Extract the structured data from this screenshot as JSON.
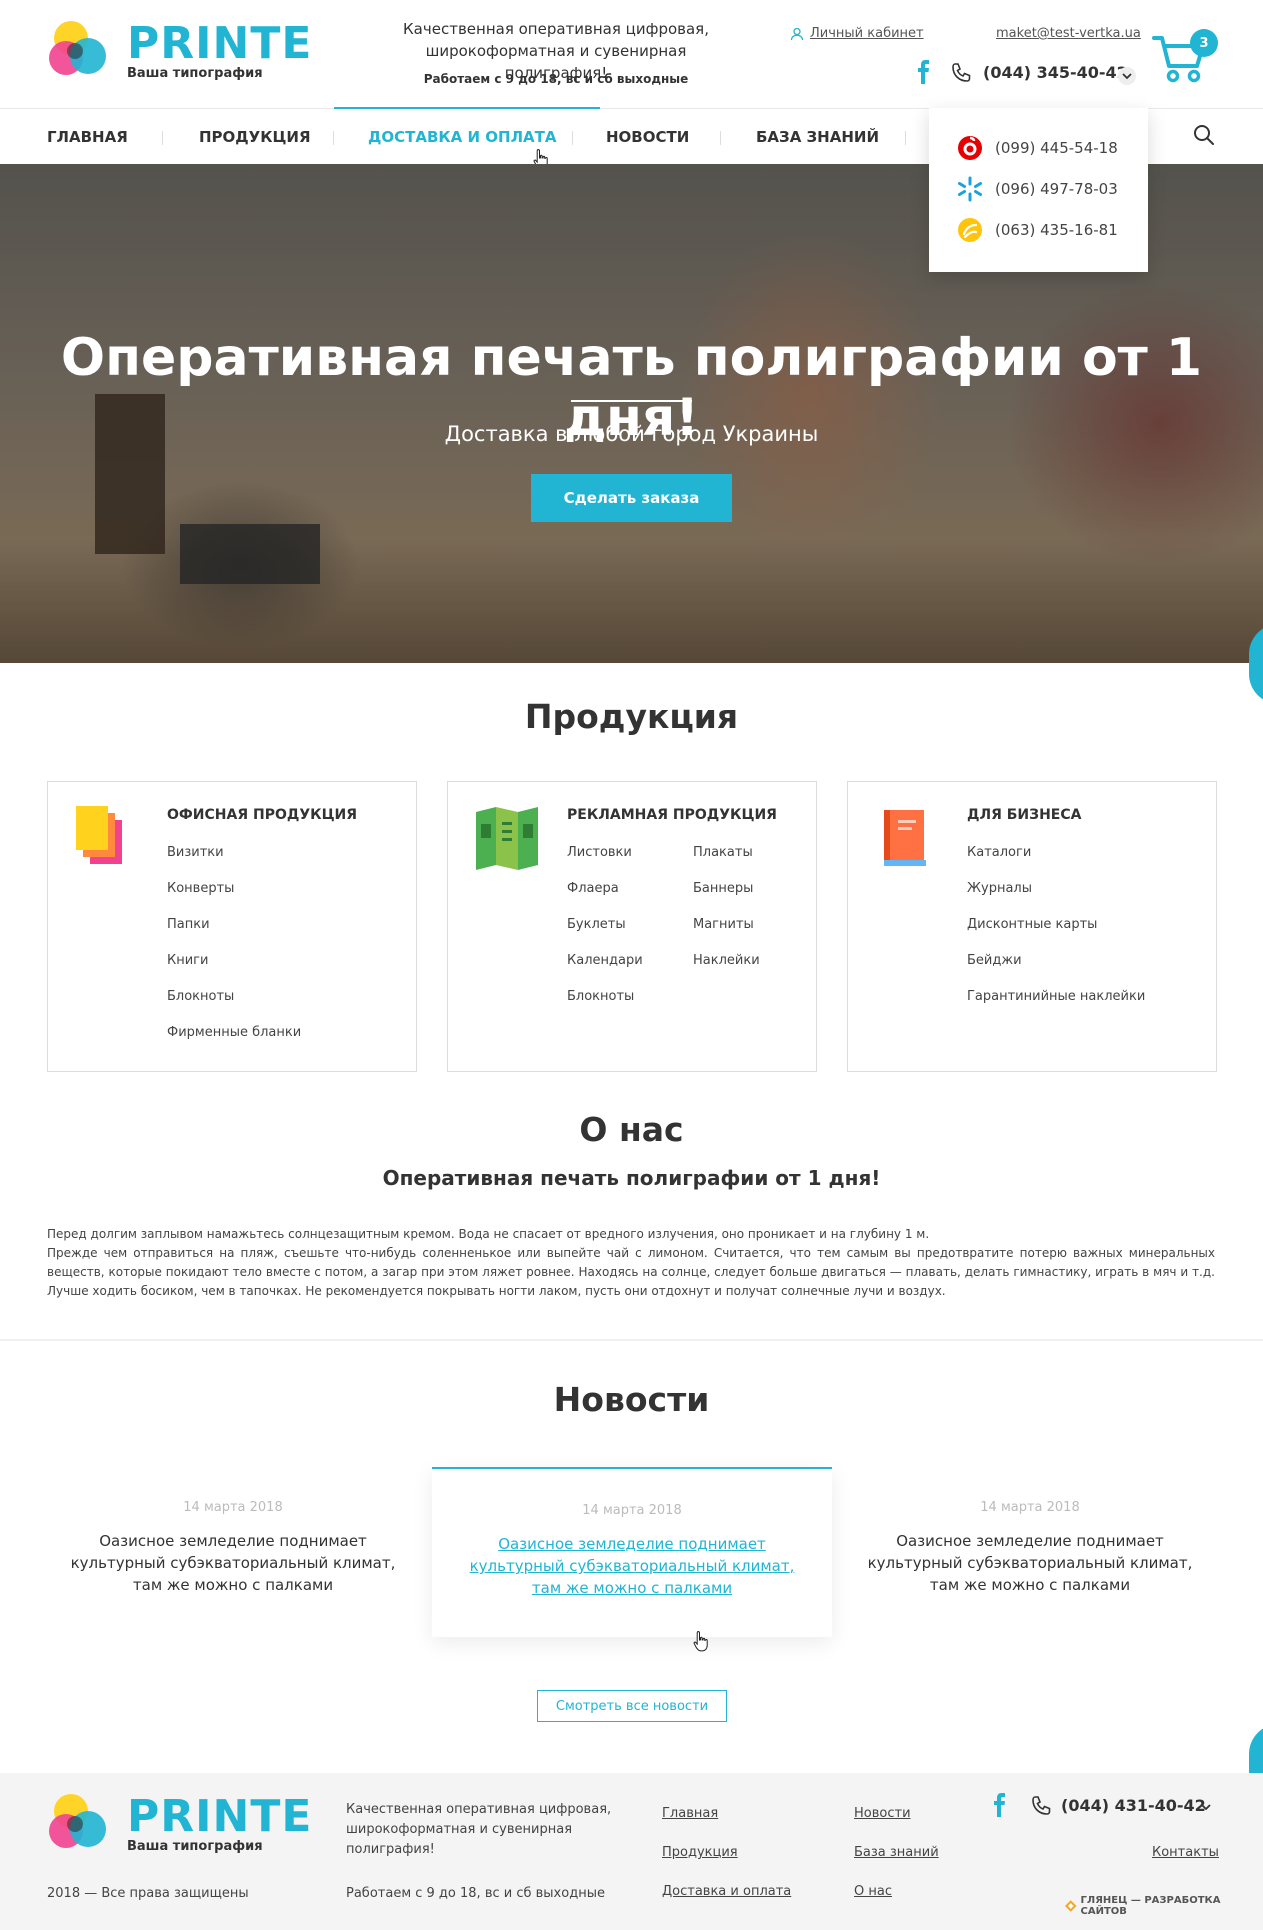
{
  "brand": {
    "name": "PRINTE",
    "tagline": "Ваша типография",
    "accent": "#21b5d3"
  },
  "header": {
    "info": "Качественная оперативная цифровая, широкоформатная и сувенирная полиграфия!",
    "hours": "Работаем с 9 до 18, вс и сб выходные",
    "cabinet_label": "Личный кабинет",
    "email": "maket@test-vertka.ua",
    "phone": "(044) 345-40-42",
    "cart_count": "3",
    "icons": [
      "user-icon",
      "facebook-icon",
      "phone-icon",
      "chevron-down-icon",
      "cart-icon",
      "search-icon"
    ]
  },
  "nav": {
    "items": [
      {
        "label": "Главная"
      },
      {
        "label": "Продукция"
      },
      {
        "label": "Доставка и оплата"
      },
      {
        "label": "Новости"
      },
      {
        "label": "База знаний"
      }
    ],
    "active": "Доставка и оплата"
  },
  "phones_dropdown": {
    "items": [
      {
        "operator_icon": "vodafone-icon",
        "color": "#e60000",
        "number": "(099) 445-54-18"
      },
      {
        "operator_icon": "kyivstar-icon",
        "color": "#1ba0e1",
        "number": "(096) 497-78-03"
      },
      {
        "operator_icon": "lifecell-icon",
        "color": "#ffc40c",
        "number": "(063) 435-16-81"
      }
    ]
  },
  "hero": {
    "title": "Оперативная печать полиграфии от 1 дня!",
    "subtitle": "Доставка в любой город Украины",
    "button_label": "Сделать заказа"
  },
  "products": {
    "title": "Продукция",
    "categories": [
      {
        "title": "Офисная продукция",
        "icon": "papers-icon",
        "columns": [
          [
            "Визитки",
            "Конверты",
            "Папки",
            "Книги",
            "Блокноты",
            "Фирменные бланки"
          ]
        ]
      },
      {
        "title": "Рекламная продукция",
        "icon": "brochure-icon",
        "columns": [
          [
            "Листовки",
            "Флаера",
            "Буклеты",
            "Календари",
            "Блокноты"
          ],
          [
            "Плакаты",
            "Баннеры",
            "Магниты",
            "Наклейки"
          ]
        ]
      },
      {
        "title": "Для бизнеса",
        "icon": "book-icon",
        "columns": [
          [
            "Каталоги",
            "Журналы",
            "Дисконтные карты",
            "Бейджи",
            "Гарантинийные наклейки"
          ]
        ]
      }
    ]
  },
  "about": {
    "title": "О нас",
    "subtitle": "Оперативная печать полиграфии от 1 дня!",
    "paragraph_1": "Перед долгим заплывом намажьтесь солнцезащитным кремом. Вода не спасает от вредного излучения, оно проникает и на глубину 1 м.",
    "paragraph_2": "Прежде чем отправиться на пляж, съешьте что-нибудь соленненькое или выпейте чай с лимоном. Считается, что тем самым вы предотвратите потерю важных минеральных веществ, которые покидают тело вместе с потом, а загар при этом ляжет ровнее. Находясь на солнце, следует больше двигаться — плавать, делать гимнастику, играть в мяч и т.д. Лучше ходить босиком, чем в тапочках. Не рекомендуется покрывать ногти лаком, пусть они отдохнут и получат солнечные лучи и воздух."
  },
  "news": {
    "title": "Новости",
    "items": [
      {
        "date": "14 марта 2018",
        "text": "Оазисное земледелие поднимает культурный субэкваториальный климат, там же можно с палками"
      },
      {
        "date": "14 марта 2018",
        "text": "Оазисное земледелие поднимает культурный субэкваториальный климат, там же можно с палками"
      },
      {
        "date": "14 марта 2018",
        "text": "Оазисное земледелие поднимает культурный субэкваториальный климат, там же можно с палками"
      }
    ],
    "all_label": "Смотреть все новости"
  },
  "footer": {
    "copyright": "2018 — Все права защищены",
    "info": "Качественная оперативная цифровая, широкоформатная и сувенирная полиграфия!",
    "hours": "Работаем с 9 до 18, вс и сб выходные",
    "links_col1": [
      "Главная",
      "Продукция",
      "Доставка и оплата"
    ],
    "links_col2": [
      "Новости",
      "База знаний",
      "О нас"
    ],
    "contacts_label": "Контакты",
    "phone": "(044) 431-40-42",
    "developer": "ГЛЯНЕЦ — РАЗРАБОТКА САЙТОВ"
  }
}
